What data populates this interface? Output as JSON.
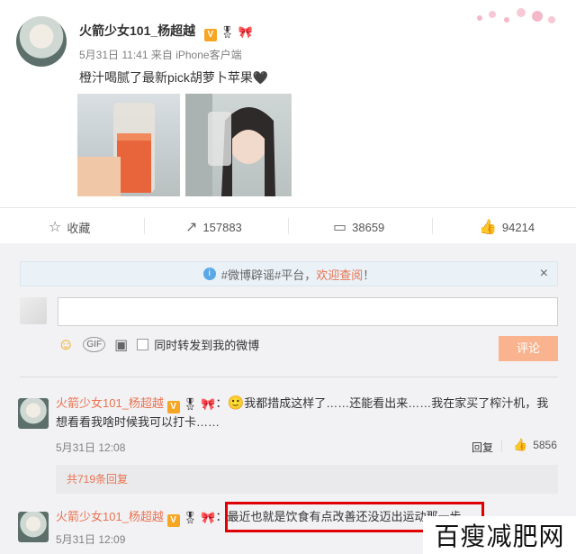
{
  "post": {
    "username": "火箭少女101_杨超越",
    "verified_badge": "V",
    "timestamp": "5月31日 11:41",
    "source_prefix": "来自",
    "source": "iPhone客户端",
    "text": "橙汁喝腻了最新pick胡萝卜苹果🖤"
  },
  "actions": {
    "favorite_label": "收藏",
    "share_count": "157883",
    "comment_count": "38659",
    "like_count": "94214"
  },
  "notice": {
    "prefix": "#微博辟谣#平台，",
    "link": "欢迎查阅",
    "suffix": "！",
    "close": "×"
  },
  "composer": {
    "placeholder": "",
    "repost_label": "同时转发到我的微博",
    "submit_label": "评论"
  },
  "comments": [
    {
      "username": "火箭少女101_杨超越",
      "emoji": "🙂",
      "text": "我都措成这样了……还能看出来……我在家买了榨汁机，我想看看我啥时候我可以打卡……",
      "timestamp": "5月31日 12:08",
      "reply_label": "回复",
      "like_count": "5856",
      "replies_label": "共719条回复"
    },
    {
      "username": "火箭少女101_杨超越",
      "text": "最近也就是饮食有点改善还没迈出运动那一步",
      "timestamp": "5月31日 12:09"
    }
  ],
  "watermark": "百瘦减肥网",
  "colors": {
    "accent": "#eb7350",
    "submit_bg": "#f9b48f",
    "notice_bg": "#f2f6f9",
    "highlight": "#e00000"
  }
}
